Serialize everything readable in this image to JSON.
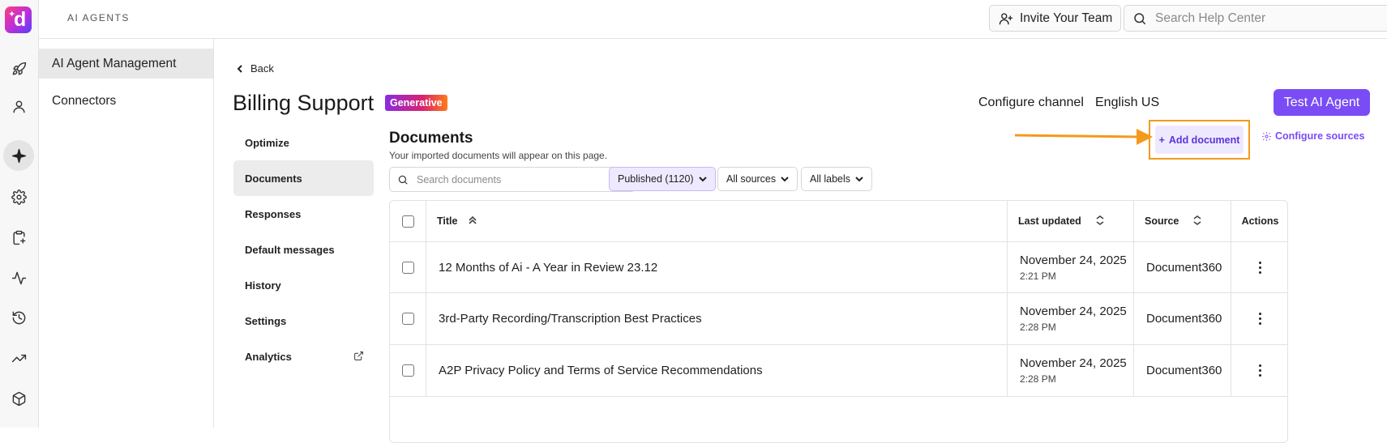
{
  "rail": {
    "logo_letter": "d",
    "icons": [
      "rocket-icon",
      "user-icon",
      "sparkle-icon",
      "settings-icon",
      "clipboard-icon",
      "activity-icon",
      "history-icon",
      "trending-icon",
      "box-icon"
    ]
  },
  "topbar": {
    "app_title": "AI AGENTS",
    "invite_label": "Invite Your Team",
    "help_search_placeholder": "Search Help Center"
  },
  "subnav": {
    "items": [
      {
        "label": "AI Agent Management",
        "active": true
      },
      {
        "label": "Connectors",
        "active": false
      }
    ]
  },
  "header": {
    "back_label": "Back",
    "title": "Billing Support",
    "badge": "Generative",
    "configure_channel": "Configure channel",
    "language": "English US",
    "test_button": "Test AI Agent"
  },
  "tabs": [
    {
      "label": "Optimize",
      "active": false
    },
    {
      "label": "Documents",
      "active": true
    },
    {
      "label": "Responses",
      "active": false
    },
    {
      "label": "Default messages",
      "active": false
    },
    {
      "label": "History",
      "active": false
    },
    {
      "label": "Settings",
      "active": false
    },
    {
      "label": "Analytics",
      "active": false
    }
  ],
  "documents": {
    "title": "Documents",
    "subtitle": "Your imported documents will appear on this page.",
    "add_button": "Add document",
    "configure_sources": "Configure sources",
    "search_placeholder": "Search documents",
    "filters": {
      "status": "Published (1120)",
      "sources": "All sources",
      "labels": "All labels"
    },
    "columns": {
      "title": "Title",
      "last_updated": "Last updated",
      "source": "Source",
      "actions": "Actions"
    },
    "rows": [
      {
        "title": "12 Months of Ai - A Year in Review 23.12",
        "date": "November 24, 2025",
        "time": "2:21 PM",
        "source": "Document360"
      },
      {
        "title": "3rd-Party Recording/Transcription Best Practices",
        "date": "November 24, 2025",
        "time": "2:28 PM",
        "source": "Document360"
      },
      {
        "title": "A2P Privacy Policy and Terms of Service Recommendations",
        "date": "November 24, 2025",
        "time": "2:28 PM",
        "source": "Document360"
      }
    ]
  },
  "colors": {
    "accent": "#7a4cf5",
    "highlight": "#f39a1c"
  }
}
